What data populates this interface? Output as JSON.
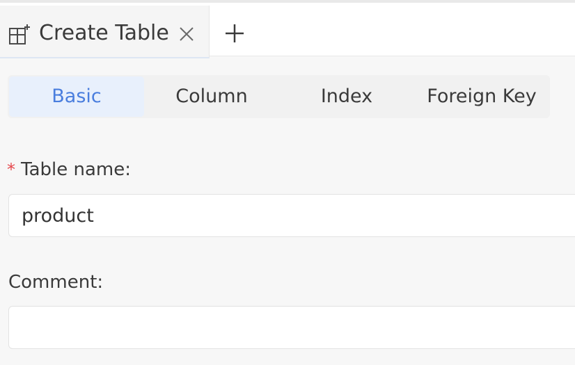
{
  "tabs": [
    {
      "title": "Create Table",
      "icon": "table-icon"
    }
  ],
  "tabbar": {
    "close_icon": "close-icon",
    "add_icon": "plus-icon"
  },
  "segments": {
    "items": [
      "Basic",
      "Column",
      "Index",
      "Foreign Key"
    ],
    "active": "Basic"
  },
  "form": {
    "table_name": {
      "required_mark": "*",
      "label": "Table name:",
      "value": "product"
    },
    "comment": {
      "label": "Comment:",
      "value": ""
    }
  },
  "colors": {
    "accent": "#4a7ede",
    "active_segment_bg": "#e8f0fc",
    "required": "#e5484d"
  }
}
